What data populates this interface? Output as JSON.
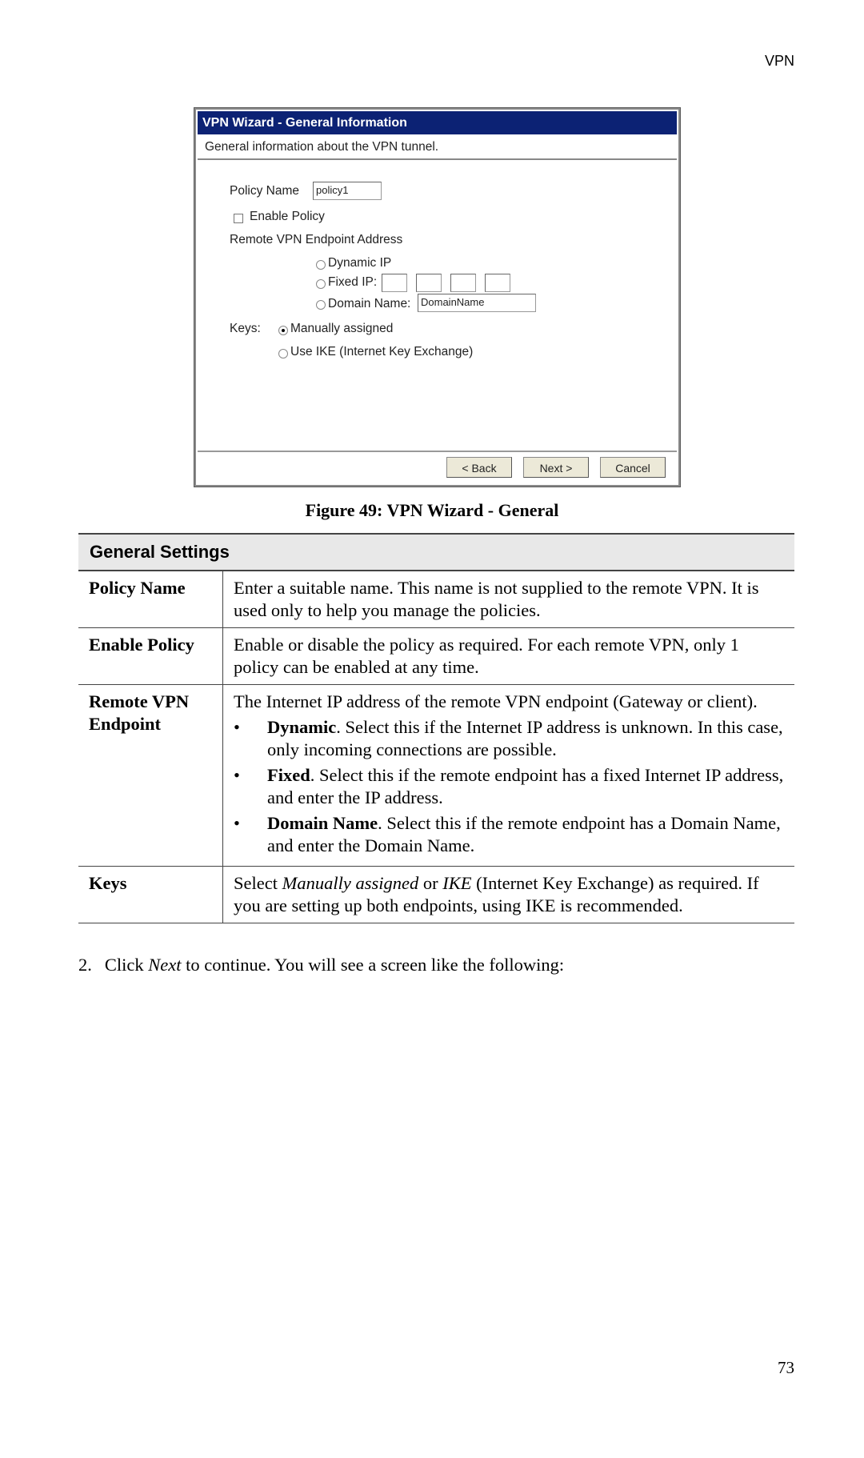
{
  "header": {
    "section": "VPN"
  },
  "dialog": {
    "title": "VPN Wizard - General Information",
    "subtitle": "General information about the VPN tunnel.",
    "policy_name_label": "Policy Name",
    "policy_name_value": "policy1",
    "enable_policy_label": "Enable Policy",
    "enable_policy_checked": false,
    "remote_label": "Remote VPN Endpoint Address",
    "dynamic_ip_label": "Dynamic IP",
    "fixed_ip_label": "Fixed IP:",
    "fixed_ip_values": [
      "",
      "",
      "",
      ""
    ],
    "domain_name_label": "Domain Name:",
    "domain_name_value": "DomainName",
    "keys_label": "Keys:",
    "keys_manual_label": "Manually assigned",
    "keys_ike_label": "Use IKE (Internet Key Exchange)",
    "keys_selected": "Manually assigned",
    "buttons": {
      "back": "< Back",
      "next": "Next >",
      "cancel": "Cancel"
    },
    "colors": {
      "titlebar": "#0c2274",
      "button": "#ece9d8"
    }
  },
  "figure_caption": "Figure 49: VPN Wizard - General",
  "table": {
    "heading": "General Settings",
    "rows": [
      {
        "key": "Policy Name",
        "desc": "Enter a suitable name. This name is not supplied to the remote VPN. It is used only to help you manage the policies."
      },
      {
        "key": "Enable Policy",
        "desc": "Enable or disable the policy as required. For each remote VPN, only 1 policy can be enabled at any time."
      },
      {
        "key": "Remote VPN Endpoint",
        "desc": "The Internet IP address of the remote VPN endpoint (Gateway or client).",
        "bullets": [
          {
            "term": "Dynamic",
            "text": ". Select this if the Internet IP address is unknown. In this case, only incoming connections are possible."
          },
          {
            "term": "Fixed",
            "text": ". Select this if the remote endpoint has a fixed Internet IP address, and enter the IP address."
          },
          {
            "term": "Domain Name",
            "text": ". Select this if the remote endpoint has a Domain Name, and enter the Domain Name."
          }
        ]
      },
      {
        "key": "Keys",
        "desc_parts": [
          "Select ",
          "Manually assigned",
          " or ",
          "IKE",
          " (Internet Key Exchange) as required. If you are setting up both endpoints, using IKE is recommended."
        ]
      }
    ]
  },
  "step": {
    "number": "2.",
    "parts": [
      "Click ",
      "Next",
      " to continue. You will see a screen like the following:"
    ]
  },
  "page_number": "73"
}
